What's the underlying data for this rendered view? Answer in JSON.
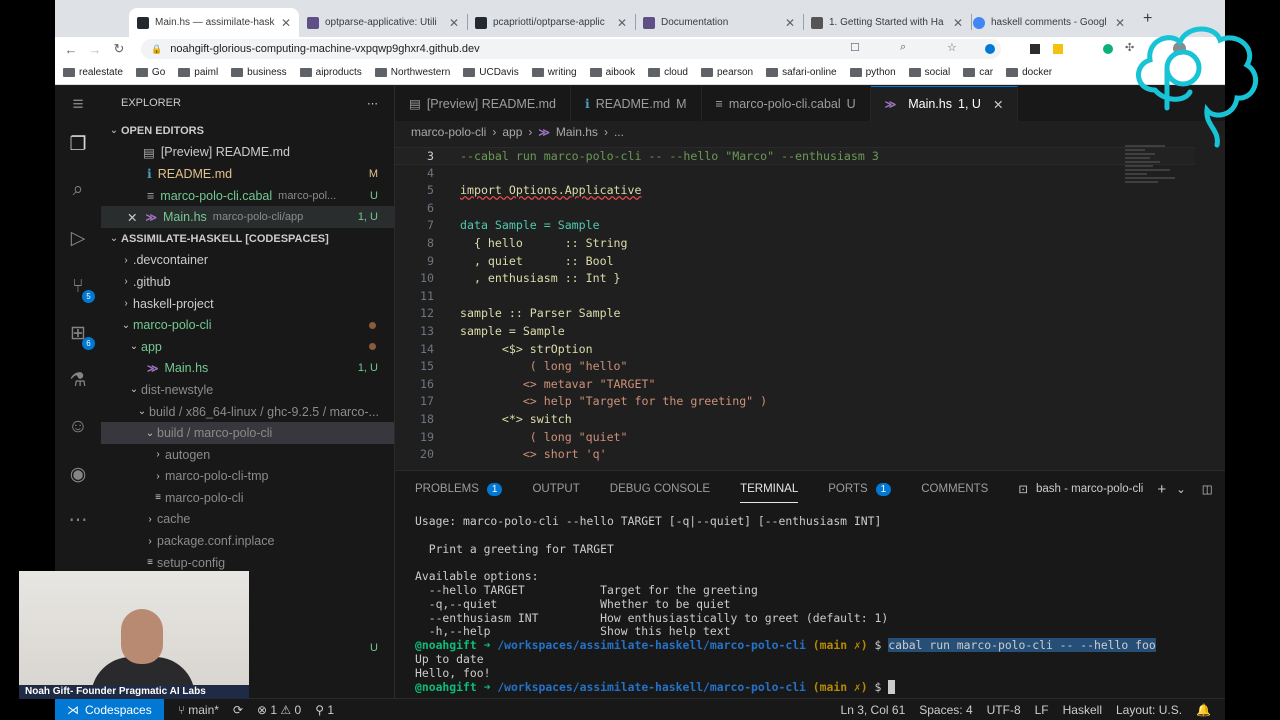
{
  "browser": {
    "tabs": [
      {
        "title": "Main.hs — assimilate-hask",
        "fav": "#24292f"
      },
      {
        "title": "optparse-applicative: Utili",
        "fav": "#5e5086"
      },
      {
        "title": "pcapriotti/optparse-applic",
        "fav": "#24292f"
      },
      {
        "title": "Documentation",
        "fav": "#5e5086"
      },
      {
        "title": "1. Getting Started with Ha",
        "fav": "#555"
      },
      {
        "title": "haskell comments - Googl",
        "fav": "#4285f4"
      }
    ],
    "url": "noahgift-glorious-computing-machine-vxpqwp9ghxr4.github.dev",
    "bookmarks": [
      "realestate",
      "Go",
      "paiml",
      "business",
      "aiproducts",
      "Northwestern",
      "UCDavis",
      "writing",
      "aibook",
      "cloud",
      "pearson",
      "safari-online",
      "python",
      "social",
      "car",
      "docker"
    ]
  },
  "sidebar": {
    "title": "EXPLORER",
    "open_editors_label": "OPEN EDITORS",
    "open_editors": [
      {
        "name": "[Preview] README.md",
        "badge": "",
        "dim": ""
      },
      {
        "name": "README.md",
        "badge": "M",
        "dim": ""
      },
      {
        "name": "marco-polo-cli.cabal",
        "badge": "U",
        "dim": "marco-pol..."
      },
      {
        "name": "Main.hs",
        "badge": "1, U",
        "dim": "marco-polo-cli/app"
      }
    ],
    "workspace_label": "ASSIMILATE-HASKELL [CODESPACES]",
    "tree": [
      {
        "name": ".devcontainer",
        "badge": ""
      },
      {
        "name": ".github",
        "badge": ""
      },
      {
        "name": "haskell-project",
        "badge": ""
      },
      {
        "name": "marco-polo-cli",
        "badge": ""
      },
      {
        "name": "app",
        "badge": ""
      },
      {
        "name": "Main.hs",
        "badge": "1, U"
      },
      {
        "name": "dist-newstyle",
        "badge": ""
      },
      {
        "name": "build / x86_64-linux / ghc-9.2.5 / marco-...",
        "badge": ""
      },
      {
        "name": "build / marco-polo-cli",
        "badge": ""
      },
      {
        "name": "autogen",
        "badge": ""
      },
      {
        "name": "marco-polo-cli-tmp",
        "badge": ""
      },
      {
        "name": "marco-polo-cli",
        "badge": ""
      },
      {
        "name": "cache",
        "badge": ""
      },
      {
        "name": "package.conf.inplace",
        "badge": ""
      },
      {
        "name": "setup-config",
        "badge": ""
      }
    ],
    "bottom_badge": "U"
  },
  "editor": {
    "tabs": [
      {
        "label": "[Preview] README.md",
        "badge": ""
      },
      {
        "label": "README.md",
        "badge": "M"
      },
      {
        "label": "marco-polo-cli.cabal",
        "badge": "U"
      },
      {
        "label": "Main.hs",
        "badge": "1, U"
      }
    ],
    "breadcrumb": [
      "marco-polo-cli",
      "app",
      "Main.hs",
      "..."
    ],
    "lines": [
      {
        "n": "3",
        "text": "--cabal run marco-polo-cli -- --hello \"Marco\" --enthusiasm 3"
      },
      {
        "n": "4",
        "text": ""
      },
      {
        "n": "5",
        "text": "import Options.Applicative"
      },
      {
        "n": "6",
        "text": ""
      },
      {
        "n": "7",
        "text": "data Sample = Sample"
      },
      {
        "n": "8",
        "text": "  { hello      :: String"
      },
      {
        "n": "9",
        "text": "  , quiet      :: Bool"
      },
      {
        "n": "10",
        "text": "  , enthusiasm :: Int }"
      },
      {
        "n": "11",
        "text": ""
      },
      {
        "n": "12",
        "text": "sample :: Parser Sample"
      },
      {
        "n": "13",
        "text": "sample = Sample"
      },
      {
        "n": "14",
        "text": "      <$> strOption"
      },
      {
        "n": "15",
        "text": "          ( long \"hello\""
      },
      {
        "n": "16",
        "text": "         <> metavar \"TARGET\""
      },
      {
        "n": "17",
        "text": "         <> help \"Target for the greeting\" )"
      },
      {
        "n": "18",
        "text": "      <*> switch"
      },
      {
        "n": "19",
        "text": "          ( long \"quiet\""
      },
      {
        "n": "20",
        "text": "         <> short 'q'"
      }
    ]
  },
  "panel": {
    "tabs": [
      {
        "label": "PROBLEMS",
        "badge": "1"
      },
      {
        "label": "OUTPUT",
        "badge": ""
      },
      {
        "label": "DEBUG CONSOLE",
        "badge": ""
      },
      {
        "label": "TERMINAL",
        "badge": ""
      },
      {
        "label": "PORTS",
        "badge": "1"
      },
      {
        "label": "COMMENTS",
        "badge": ""
      }
    ],
    "terminal_name": "bash - marco-polo-cli",
    "terminal": [
      "Usage: marco-polo-cli --hello TARGET [-q|--quiet] [--enthusiasm INT]",
      "",
      "  Print a greeting for TARGET",
      "",
      "Available options:",
      "  --hello TARGET           Target for the greeting",
      "  -q,--quiet               Whether to be quiet",
      "  --enthusiasm INT         How enthusiastically to greet (default: 1)",
      "  -h,--help                Show this help text"
    ],
    "prompt_user": "@noahgift",
    "prompt_path": "/workspaces/assimilate-haskell/marco-polo-cli",
    "prompt_branch": "(main ✗)",
    "cmd": "cabal run marco-polo-cli -- --hello foo",
    "out": [
      "Up to date",
      "Hello, foo!"
    ]
  },
  "status": {
    "remote": "Codespaces",
    "branch": "main*",
    "problems": "⊗ 1 ⚠ 0",
    "ports": "1",
    "position": "Ln 3, Col 61",
    "spaces": "Spaces: 4",
    "encoding": "UTF-8",
    "eol": "LF",
    "lang": "Haskell",
    "layout": "Layout: U.S."
  },
  "webcam": {
    "caption": "Noah Gift- Founder Pragmatic AI Labs"
  }
}
